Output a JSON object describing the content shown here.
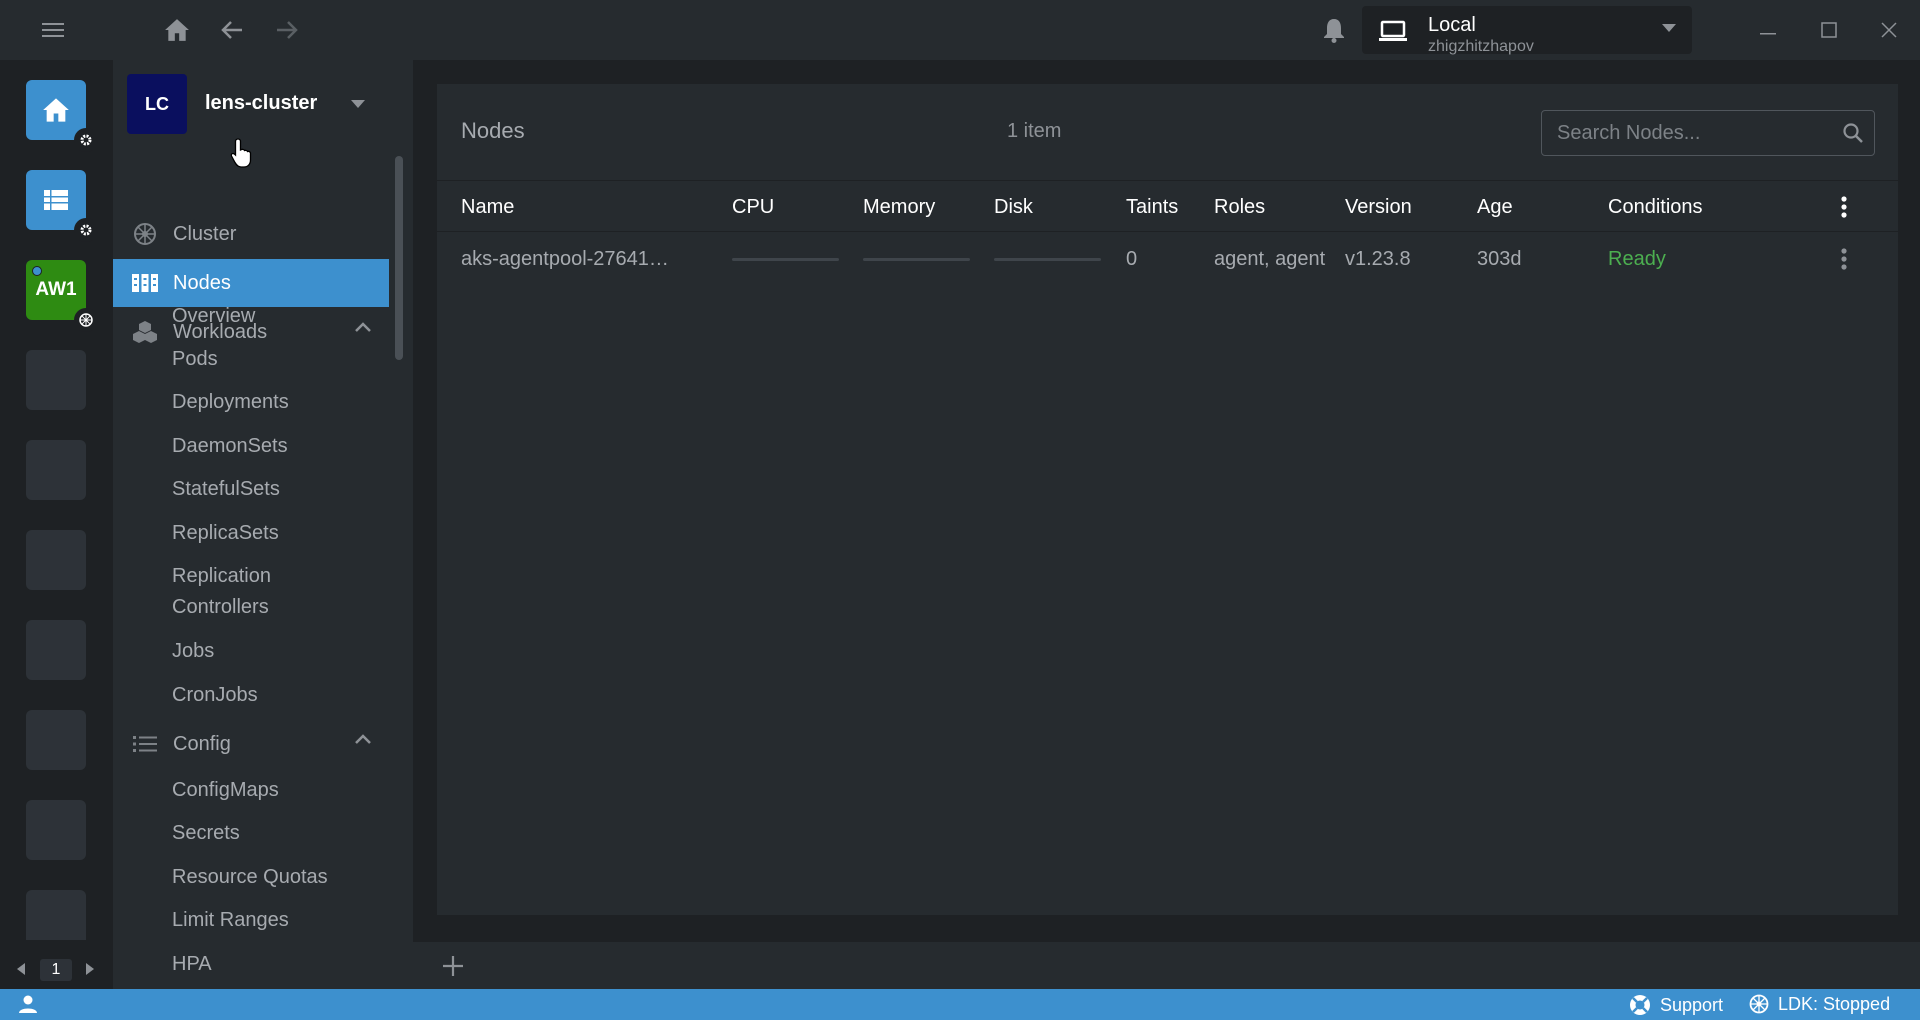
{
  "topbar": {
    "context": {
      "title": "Local",
      "subtitle": "zhigzhitzhapov"
    }
  },
  "hotbar": {
    "items": [
      {
        "type": "home",
        "color": "#3d90ce"
      },
      {
        "type": "catalog",
        "color": "#3d90ce"
      },
      {
        "type": "cluster",
        "label": "AW1",
        "color": "#2e8b12"
      }
    ],
    "page": "1"
  },
  "sidebar": {
    "cluster": {
      "avatar": "LC",
      "name": "lens-cluster"
    },
    "items": {
      "cluster": "Cluster",
      "nodes": "Nodes",
      "workloads": "Workloads",
      "config": "Config"
    },
    "workloads_children": [
      "Overview",
      "Pods",
      "Deployments",
      "DaemonSets",
      "StatefulSets",
      "ReplicaSets",
      "Replication Controllers",
      "Jobs",
      "CronJobs"
    ],
    "config_children": [
      "ConfigMaps",
      "Secrets",
      "Resource Quotas",
      "Limit Ranges",
      "HPA"
    ]
  },
  "main": {
    "title": "Nodes",
    "count": "1 item",
    "search_placeholder": "Search Nodes...",
    "columns": [
      "Name",
      "CPU",
      "Memory",
      "Disk",
      "Taints",
      "Roles",
      "Version",
      "Age",
      "Conditions"
    ],
    "rows": [
      {
        "name": "aks-agentpool-27641…",
        "cpu_usage": 0,
        "memory_usage": 0,
        "disk_usage": 0,
        "taints": "0",
        "roles": "agent, agent",
        "version": "v1.23.8",
        "age": "303d",
        "conditions": "Ready"
      }
    ]
  },
  "statusbar": {
    "support": "Support",
    "ldk": "LDK: Stopped"
  },
  "colors": {
    "accent": "#3d90ce",
    "ready": "#4caf50",
    "cluster_green": "#2e8b12",
    "avatar_navy": "#0a0f5e"
  }
}
